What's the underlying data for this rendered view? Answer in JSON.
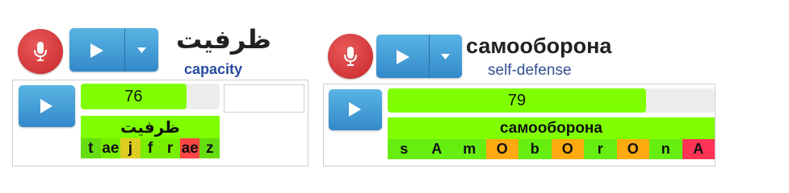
{
  "panel1": {
    "word": "ظرفيت",
    "translation": "capacity",
    "score": "76",
    "score_fraction": 0.76,
    "feedback_word": "ظرفيت",
    "phonemes": [
      {
        "label": "t",
        "color": "#66dd11"
      },
      {
        "label": "ae",
        "color": "#77ee00"
      },
      {
        "label": "j",
        "color": "#ddcc22"
      },
      {
        "label": "f",
        "color": "#77ee00"
      },
      {
        "label": "r",
        "color": "#77ee00"
      },
      {
        "label": "ae",
        "color": "#ff4444"
      },
      {
        "label": "z",
        "color": "#66dd11"
      }
    ]
  },
  "panel2": {
    "word": "самооборона",
    "translation": "self-defense",
    "score": "79",
    "score_fraction": 0.79,
    "feedback_word": "самооборона",
    "phonemes": [
      {
        "label": "s",
        "color": "#66ee11"
      },
      {
        "label": "A",
        "color": "#66ee11"
      },
      {
        "label": "m",
        "color": "#66ee11"
      },
      {
        "label": "O",
        "color": "#ffaa11"
      },
      {
        "label": "b",
        "color": "#66ee11"
      },
      {
        "label": "O",
        "color": "#ffaa11"
      },
      {
        "label": "r",
        "color": "#66ee11"
      },
      {
        "label": "O",
        "color": "#ffaa11"
      },
      {
        "label": "n",
        "color": "#66ee11"
      },
      {
        "label": "A",
        "color": "#ff3355"
      }
    ]
  },
  "colors": {
    "bar_green": "#7fff00",
    "translation_blue_1": "#2a4aa0",
    "translation_blue_2": "#33508f"
  },
  "icons": [
    "microphone-icon",
    "play-icon",
    "caret-down-icon"
  ]
}
